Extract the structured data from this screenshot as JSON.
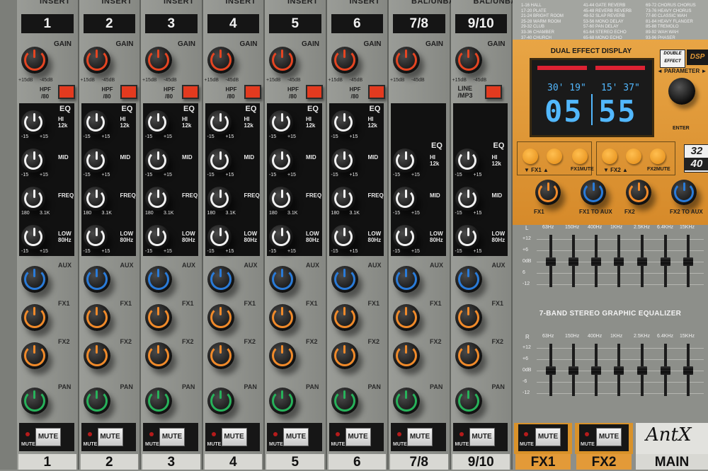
{
  "channels": [
    {
      "id": "ch1",
      "number": "1",
      "insert": "INSERT",
      "stereo": false
    },
    {
      "id": "ch2",
      "number": "2",
      "insert": "INSERT",
      "stereo": false
    },
    {
      "id": "ch3",
      "number": "3",
      "insert": "INSERT",
      "stereo": false
    },
    {
      "id": "ch4",
      "number": "4",
      "insert": "INSERT",
      "stereo": false
    },
    {
      "id": "ch5",
      "number": "5",
      "insert": "INSERT",
      "stereo": false
    },
    {
      "id": "ch6",
      "number": "6",
      "insert": "INSERT",
      "stereo": false
    },
    {
      "id": "ch78",
      "number": "7/8",
      "insert": "BAL/UNBAL",
      "stereo": true
    },
    {
      "id": "ch910",
      "number": "9/10",
      "insert": "BAL/UNBAL",
      "stereo": true
    }
  ],
  "labels": {
    "gain": "GAIN",
    "gain_top": "-10dBv",
    "gain_scale_left": "+15dB",
    "gain_scale_right": "-45dB",
    "hpf": "HPF",
    "hpf_freq": "80",
    "line_mp3": "LINE\n/MP3",
    "eq": "EQ",
    "hi": "HI",
    "hi_freq": "12k",
    "mid": "MID",
    "freq": "FREQ",
    "low": "LOW",
    "low_freq": "80Hz",
    "scale_neg": "-15",
    "scale_pos": "+15",
    "scale_zero": "0",
    "freq_lo": "300",
    "freq_hi": "1K",
    "freq_min": "180",
    "freq_max": "3.1K",
    "aux": "AUX",
    "fx1": "FX1",
    "fx2": "FX2",
    "pan": "PAN",
    "mute": "MUTE",
    "aux_scale_lo": "0",
    "aux_scale_hi": "+15"
  },
  "presets": [
    {
      "num": "1-16",
      "name": "HALL"
    },
    {
      "num": "17-20",
      "name": "PLATE"
    },
    {
      "num": "21-24",
      "name": "BRIGHT ROOM"
    },
    {
      "num": "25-28",
      "name": "WARM ROOM"
    },
    {
      "num": "29-32",
      "name": "CLUB"
    },
    {
      "num": "33-36",
      "name": "CHAMBER"
    },
    {
      "num": "37-40",
      "name": "CHURCH"
    },
    {
      "num": "41-44",
      "name": "GATE REVERB"
    },
    {
      "num": "45-48",
      "name": "REVERB REVERB"
    },
    {
      "num": "49-52",
      "name": "SLAP REVERB"
    },
    {
      "num": "53-56",
      "name": "MONO DELAY"
    },
    {
      "num": "57-60",
      "name": "PAN DELAY"
    },
    {
      "num": "61-64",
      "name": "STEREO ECHO"
    },
    {
      "num": "65-68",
      "name": "MONO ECHO"
    },
    {
      "num": "69-72",
      "name": "CHORUS CHORUS"
    },
    {
      "num": "73-76",
      "name": "HEAVY CHORUS"
    },
    {
      "num": "77-80",
      "name": "CLASSIC WAH"
    },
    {
      "num": "81-84",
      "name": "HEAVY FLANGER"
    },
    {
      "num": "85-88",
      "name": "TREMOLO"
    },
    {
      "num": "89-92",
      "name": "WAH WAH"
    },
    {
      "num": "93-96",
      "name": "PHASER"
    }
  ],
  "fx_display": {
    "title": "DUAL EFFECT DISPLAY",
    "double_effect": "DOUBLE\nEFFECT",
    "parameter": "PARAMETER",
    "fx1_param": "30' 19\"",
    "fx2_param": "15' 37\"",
    "fx1_value": "05",
    "fx2_value": "55",
    "enter": "ENTER",
    "fx1_label": "FX1",
    "fx2_label": "FX2",
    "fx1_mute": "FX1MUTE",
    "fx2_mute": "FX2MUTE",
    "badge_top": "32",
    "badge_bottom": "40"
  },
  "fx_knobs": [
    {
      "id": "fx1",
      "label": "FX1",
      "color": "#f08a2a"
    },
    {
      "id": "fx1-to-aux",
      "label": "FX1 TO AUX",
      "color": "#2a7bd8"
    },
    {
      "id": "fx2",
      "label": "FX2",
      "color": "#f08a2a"
    },
    {
      "id": "fx2-to-aux",
      "label": "FX2 TO AUX",
      "color": "#2a7bd8"
    }
  ],
  "graphic_eq": {
    "title": "7-BAND STEREO GRAPHIC EQUALIZER",
    "bands": [
      "63Hz",
      "150Hz",
      "400Hz",
      "1KHz",
      "2.5KHz",
      "6.4KHz",
      "15KHz"
    ],
    "left_label": "L",
    "right_label": "R",
    "db_scale": [
      "+12",
      "+6",
      "0dB",
      "6",
      "-12"
    ],
    "db_scale_right": [
      "+12",
      "+6",
      "0dB",
      "-6",
      "-12"
    ]
  },
  "outputs": {
    "fx1": "FX1",
    "fx2": "FX2",
    "main": "MAIN",
    "brand": "AntX"
  },
  "colors": {
    "aux": "#2a7bd8",
    "fx": "#f08a2a",
    "pan": "#27b25a",
    "gain": "#e54522",
    "eq": "#f2f2f2",
    "hpf_button": "#e33a1f",
    "display_text": "#52b8ff",
    "fx_panel": "#e39a38"
  }
}
